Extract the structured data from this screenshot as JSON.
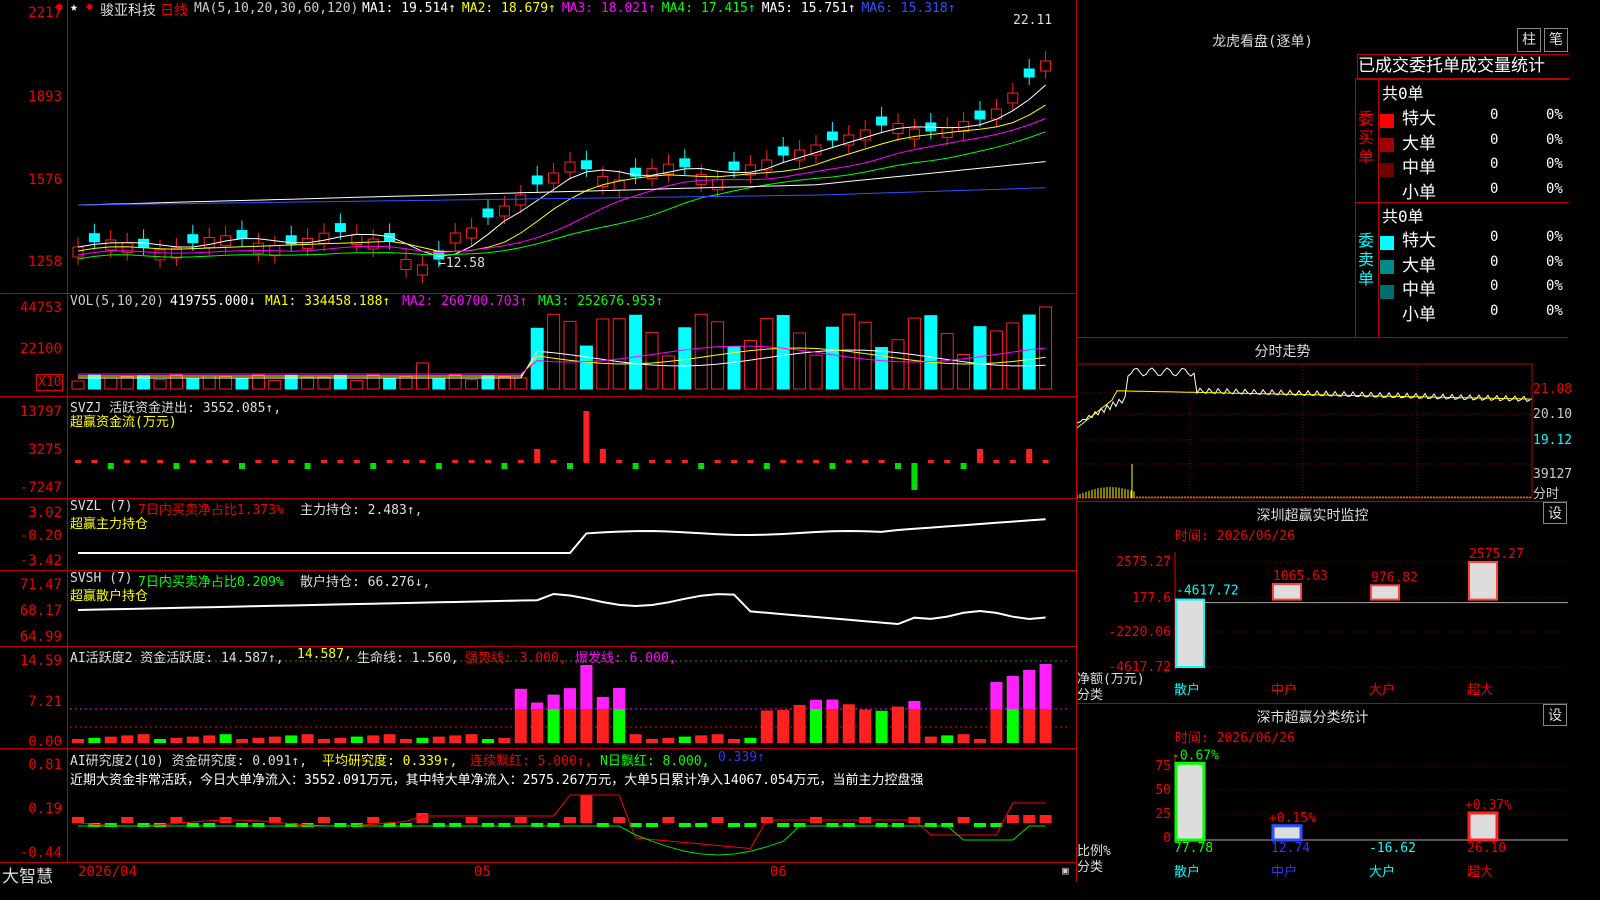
{
  "stock": {
    "name": "骏亚科技",
    "period": "日线",
    "ma_label": "MA(5,10,20,30,60,120)",
    "ma": [
      {
        "k": "MA1:",
        "v": "19.514↑",
        "c": "#ffffff"
      },
      {
        "k": "MA2:",
        "v": "18.679↑",
        "c": "#ffff00"
      },
      {
        "k": "MA3:",
        "v": "18.021↑",
        "c": "#ff00ff"
      },
      {
        "k": "MA4:",
        "v": "17.415↑",
        "c": "#00ff00"
      },
      {
        "k": "MA5:",
        "v": "15.751↑",
        "c": "#ffffff"
      },
      {
        "k": "MA6:",
        "v": "15.318↑",
        "c": "#3050ff"
      }
    ],
    "high_mark": "22.11",
    "low_mark": "←12.58",
    "star": "★"
  },
  "price_axis": [
    "2217",
    "1893",
    "1576",
    "1258"
  ],
  "vol": {
    "label": "VOL(5,10,20)",
    "value": "419755.000↓",
    "ma1": "MA1: 334458.188↑",
    "ma2": "MA2: 260700.703↑",
    "ma3": "MA3: 252676.953↑",
    "axis": [
      "44753",
      "22100"
    ],
    "unit": "X10"
  },
  "svzj": {
    "label": "SVZJ  活跃资金进出: 3552.085↑,",
    "sub": "超赢资金流(万元)",
    "axis": [
      "13797",
      "3275",
      "-7247"
    ]
  },
  "svzl": {
    "label": "SVZL (7)",
    "pct": "7日内买卖净占比1.373%",
    "hold": "主力持仓: 2.483↑,",
    "sub": "超赢主力持仓",
    "axis": [
      "3.02",
      "-0.20",
      "-3.42"
    ]
  },
  "svsh": {
    "label": "SVSH (7)",
    "pct": "7日内买卖净占比0.209%",
    "hold": "散户持仓: 66.276↓,",
    "sub": "超赢散户持仓",
    "axis": [
      "71.47",
      "68.17",
      "64.99"
    ]
  },
  "ai1": {
    "label": "AI活跃度2 资金活跃度: 14.587↑,",
    "v2": "14.587,",
    "life": "生命线: 1.560,",
    "strong": "强势线: 3.000,",
    "burst": "爆发线: 6.000,",
    "axis": [
      "14.59",
      "7.21",
      "0.00"
    ]
  },
  "ai2": {
    "label": "AI研究度2(10) 资金研究度: 0.091↑,",
    "avg": "平均研究度: 0.339↑,",
    "red": "连续飘红: 5.000↑,",
    "nred": "N日飘红: 8.000,",
    "v": "0.339↑",
    "comment": "近期大资金非常活跃，今日大单净流入：3552.091万元，其中特大单净流入：2575.267万元，大单5日累计净入14067.054万元，当前主力控盘强",
    "axis": [
      "0.81",
      "0.19",
      "-0.44"
    ]
  },
  "bottom": {
    "brand": "大智慧",
    "date_start": "2026/04",
    "m05": "05",
    "m06": "06"
  },
  "dragon": {
    "title": "龙虎看盘(逐单)",
    "btn_zhu": "柱",
    "btn_bi": "笔",
    "tabs": "已成交委托单成交量统计",
    "buy_label": "委买单",
    "sell_label": "委卖单",
    "total": "共0单",
    "buy": [
      {
        "n": "特大",
        "c": "#ff0000",
        "v": "0",
        "p": "0%"
      },
      {
        "n": "大单",
        "c": "#a00000",
        "v": "0",
        "p": "0%"
      },
      {
        "n": "中单",
        "c": "#700000",
        "v": "0",
        "p": "0%"
      },
      {
        "n": "小单",
        "c": "",
        "v": "0",
        "p": "0%"
      }
    ],
    "sell": [
      {
        "n": "特大",
        "c": "#00ffff",
        "v": "0",
        "p": "0%"
      },
      {
        "n": "大单",
        "c": "#008b8b",
        "v": "0",
        "p": "0%"
      },
      {
        "n": "中单",
        "c": "#006d6d",
        "v": "0",
        "p": "0%"
      },
      {
        "n": "小单",
        "c": "",
        "v": "0",
        "p": "0%"
      }
    ]
  },
  "intraday": {
    "title": "分时走势",
    "axis": [
      "21.08",
      "20.10",
      "19.12",
      "39127"
    ],
    "fen": "分时"
  },
  "sz_monitor": {
    "title": "深圳超赢实时监控",
    "btn": "设",
    "time": "时间: 2026/06/26",
    "axis": [
      "2575.27",
      "177.6",
      "-2220.06",
      "-4617.72"
    ],
    "ylabel": "净额(万元)",
    "ylabel2": "分类",
    "bars": [
      {
        "cat": "散户",
        "val": -4617.72,
        "label": "-4617.72"
      },
      {
        "cat": "中户",
        "val": 1065.63,
        "label": "1065.63"
      },
      {
        "cat": "大户",
        "val": 976.82,
        "label": "976.82"
      },
      {
        "cat": "超大",
        "val": 2575.27,
        "label": "2575.27"
      }
    ]
  },
  "sz_class": {
    "title": "深市超赢分类统计",
    "btn": "设",
    "time": "时间: 2026/06/26",
    "axis": [
      "75",
      "50",
      "25",
      "0"
    ],
    "ylabel": "比例%",
    "ylabel2": "分类",
    "bars": [
      {
        "cat": "散户",
        "pct": 77.78,
        "label": "77.78",
        "chg": "-0.67%"
      },
      {
        "cat": "中户",
        "pct": 12.74,
        "label": "12.74",
        "chg": "+0.15%"
      },
      {
        "cat": "大户",
        "pct": 0,
        "label": "-16.62",
        "chg": ""
      },
      {
        "cat": "超大",
        "pct": 26.1,
        "label": "26.10",
        "chg": "+0.37%"
      }
    ]
  }
}
